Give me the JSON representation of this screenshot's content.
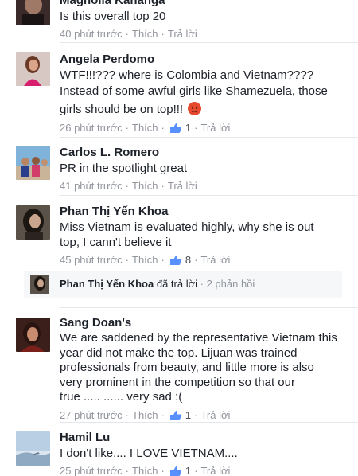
{
  "comments": [
    {
      "author": "Magnolia Kananga",
      "lines": [
        "Is this overall top 20"
      ],
      "time": "40 phút trước",
      "like_label": "Thích",
      "reply_label": "Trả lời",
      "likes": ""
    },
    {
      "author": "Angela Perdomo",
      "lines": [
        "WTF!!!??? where is Colombia and Vietnam????",
        "Instead of some awful girls like Shamezuela, those",
        "girls should be on top!!!"
      ],
      "time": "26 phút trước",
      "like_label": "Thích",
      "reply_label": "Trả lời",
      "likes": "1"
    },
    {
      "author": "Carlos L. Romero",
      "lines": [
        "PR in the spotlight great"
      ],
      "time": "41 phút trước",
      "like_label": "Thích",
      "reply_label": "Trả lời",
      "likes": ""
    },
    {
      "author": "Phan Thị Yến Khoa",
      "lines": [
        "Miss Vietnam is evaluated highly, why she is out",
        "top, I cann't believe it"
      ],
      "time": "45 phút trước",
      "like_label": "Thích",
      "reply_label": "Trả lời",
      "likes": "8"
    },
    {
      "author": "Sang Doan's",
      "lines": [
        "We are saddened by the representative Vietnam this",
        "year did not make the top. Lijuan was trained",
        "professionals from beauty, and little more is also",
        "very prominent in the competition so that our",
        "true ..... ...... very sad :("
      ],
      "time": "27 phút trước",
      "like_label": "Thích",
      "reply_label": "Trả lời",
      "likes": "1"
    },
    {
      "author": "Hamil Lu",
      "lines": [
        "I don't like.... I LOVE VIETNAM...."
      ],
      "time": "25 phút trước",
      "like_label": "Thích",
      "reply_label": "Trả lời",
      "likes": "1"
    }
  ],
  "reply_summary": {
    "author": "Phan Thị Yến Khoa",
    "action": "đã trả lời",
    "count": "2 phản hồi"
  },
  "colors": {
    "meta_gray": "#90949c",
    "text": "#1d2129",
    "divider": "#e5e6e9"
  },
  "icons": [
    "thumbs-up-icon",
    "angry-face-emoji"
  ]
}
